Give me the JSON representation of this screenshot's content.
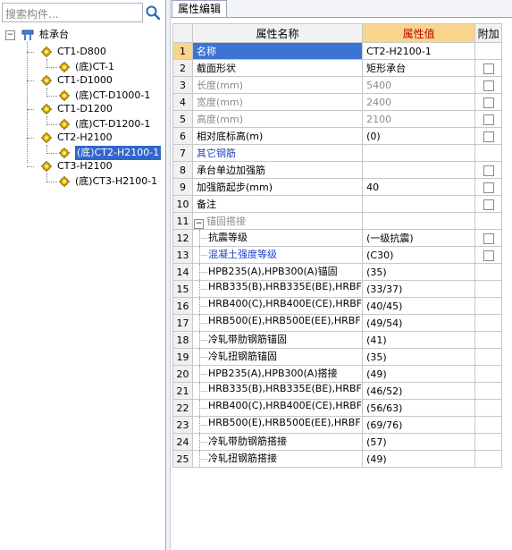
{
  "search": {
    "placeholder": "搜索构件..."
  },
  "tree": {
    "root": "桩承台",
    "nodes": [
      {
        "label": "CT1-D800",
        "child": "(底)CT-1"
      },
      {
        "label": "CT1-D1000",
        "child": "(底)CT-D1000-1"
      },
      {
        "label": "CT1-D1200",
        "child": "(底)CT-D1200-1"
      },
      {
        "label": "CT2-H2100",
        "child": "(底)CT2-H2100-1",
        "selected": true
      },
      {
        "label": "CT3-H2100",
        "child": "(底)CT3-H2100-1"
      }
    ]
  },
  "tab": {
    "label": "属性编辑"
  },
  "grid": {
    "headers": {
      "name": "属性名称",
      "value": "属性值",
      "attach": "附加"
    },
    "rows": [
      {
        "n": "1",
        "name": "名称",
        "value": "CT2-H2100-1",
        "check": false,
        "style": "current"
      },
      {
        "n": "2",
        "name": "截面形状",
        "value": "矩形承台",
        "check": true
      },
      {
        "n": "3",
        "name": "长度(mm)",
        "value": "5400",
        "check": true,
        "style": "gray"
      },
      {
        "n": "4",
        "name": "宽度(mm)",
        "value": "2400",
        "check": true,
        "style": "gray"
      },
      {
        "n": "5",
        "name": "高度(mm)",
        "value": "2100",
        "check": true,
        "style": "gray"
      },
      {
        "n": "6",
        "name": "相对底标高(m)",
        "value": "(0)",
        "check": true
      },
      {
        "n": "7",
        "name": "其它钢筋",
        "value": "",
        "check": false,
        "style": "blue"
      },
      {
        "n": "8",
        "name": "承台单边加强筋",
        "value": "",
        "check": true
      },
      {
        "n": "9",
        "name": "加强筋起步(mm)",
        "value": "40",
        "check": true
      },
      {
        "n": "10",
        "name": "备注",
        "value": "",
        "check": true
      },
      {
        "n": "11",
        "name": "锚固搭接",
        "value": "",
        "check": false,
        "style": "group"
      },
      {
        "n": "12",
        "name": "抗震等级",
        "value": "(一级抗震)",
        "check": true,
        "style": "sub"
      },
      {
        "n": "13",
        "name": "混凝土强度等级",
        "value": "(C30)",
        "check": true,
        "style": "subblue"
      },
      {
        "n": "14",
        "name": "HPB235(A),HPB300(A)锚固",
        "value": "(35)",
        "check": false,
        "style": "sub"
      },
      {
        "n": "15",
        "name": "HRB335(B),HRB335E(BE),HRBF",
        "value": "(33/37)",
        "check": false,
        "style": "sub"
      },
      {
        "n": "16",
        "name": "HRB400(C),HRB400E(CE),HRBF",
        "value": "(40/45)",
        "check": false,
        "style": "sub"
      },
      {
        "n": "17",
        "name": "HRB500(E),HRB500E(EE),HRBF",
        "value": "(49/54)",
        "check": false,
        "style": "sub"
      },
      {
        "n": "18",
        "name": "冷轧带肋钢筋锚固",
        "value": "(41)",
        "check": false,
        "style": "sub"
      },
      {
        "n": "19",
        "name": "冷轧扭钢筋锚固",
        "value": "(35)",
        "check": false,
        "style": "sub"
      },
      {
        "n": "20",
        "name": "HPB235(A),HPB300(A)搭接",
        "value": "(49)",
        "check": false,
        "style": "sub"
      },
      {
        "n": "21",
        "name": "HRB335(B),HRB335E(BE),HRBF",
        "value": "(46/52)",
        "check": false,
        "style": "sub"
      },
      {
        "n": "22",
        "name": "HRB400(C),HRB400E(CE),HRBF",
        "value": "(56/63)",
        "check": false,
        "style": "sub"
      },
      {
        "n": "23",
        "name": "HRB500(E),HRB500E(EE),HRBF",
        "value": "(69/76)",
        "check": false,
        "style": "sub"
      },
      {
        "n": "24",
        "name": "冷轧带肋钢筋搭接",
        "value": "(57)",
        "check": false,
        "style": "sub"
      },
      {
        "n": "25",
        "name": "冷轧扭钢筋搭接",
        "value": "(49)",
        "check": false,
        "style": "sub"
      }
    ]
  },
  "icons": {
    "search": "search-icon",
    "tree_root": "pile-cap-icon",
    "component": "gear-icon",
    "expander": "minus-expander-icon"
  },
  "colors": {
    "selection": "#3266cc",
    "header_highlight": "#f9d58b",
    "header_text": "#c00000",
    "link_blue": "#1f3fc6"
  }
}
